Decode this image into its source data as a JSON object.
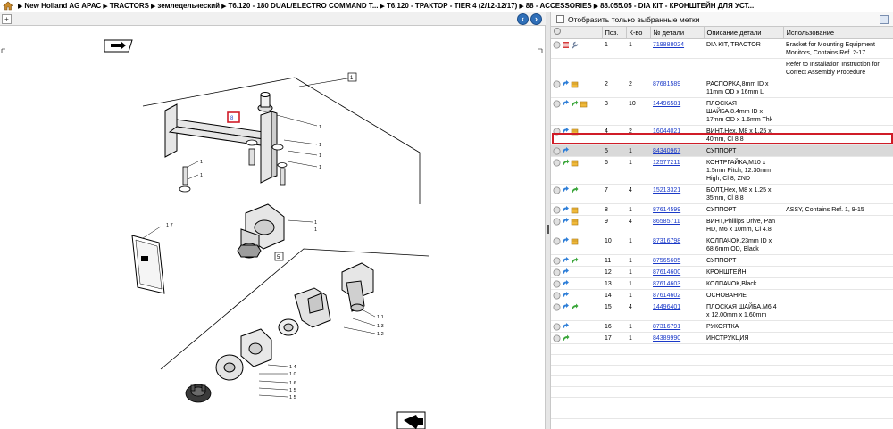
{
  "breadcrumb": {
    "items": [
      "New Holland AG APAC",
      "TRACTORS",
      "земледельческий",
      "T6.120 - 180 DUAL/ELECTRO COMMAND T...",
      "T6.120 - ТРАКТОР - TIER 4 (2/12-12/17)",
      "88 - ACCESSORIES",
      "88.055.05 - DIA КІТ - КРОНШТЕЙН ДЛЯ УСТ..."
    ]
  },
  "filter": {
    "label": "Отобразить только выбранные метки"
  },
  "table": {
    "headers": [
      "Поз.",
      "К-во",
      "№ детали",
      "Описание детали",
      "Использование"
    ],
    "rows": [
      {
        "pos": "1",
        "qty": "1",
        "part": "719888024",
        "desc": "DIA KIT, TRACTOR",
        "usage": "Bracket for Mounting Equipment Monitors, Contains Ref. 2-17"
      },
      {
        "pos": "",
        "qty": "",
        "part": "",
        "desc": "",
        "usage": "Refer to Installation Instruction for Correct Assembly Procedure"
      },
      {
        "pos": "2",
        "qty": "2",
        "part": "87681589",
        "desc": "РАСПОРКА,8mm ID x 11mm OD x 16mm L",
        "usage": ""
      },
      {
        "pos": "3",
        "qty": "10",
        "part": "14496581",
        "desc": "ПЛОСКАЯ ШАЙБА,8.4mm ID x 17mm OD x 1.6mm Thk",
        "usage": ""
      },
      {
        "pos": "4",
        "qty": "2",
        "part": "16044021",
        "desc": "ВИНТ,Hex, M8 x 1.25 x 40mm, Cl 8.8",
        "usage": ""
      },
      {
        "pos": "5",
        "qty": "1",
        "part": "84340967",
        "desc": "СУППОРТ",
        "usage": ""
      },
      {
        "pos": "6",
        "qty": "1",
        "part": "12577211",
        "desc": "КОНТРГАЙКА,M10 x 1.5mm Pitch, 12.30mm High, Cl 8, ZND",
        "usage": ""
      },
      {
        "pos": "7",
        "qty": "4",
        "part": "15213321",
        "desc": "БОЛТ,Hex, M8 x 1.25 x 35mm, Cl 8.8",
        "usage": ""
      },
      {
        "pos": "8",
        "qty": "1",
        "part": "87614599",
        "desc": "СУППОРТ",
        "usage": "ASSY, Contains Ref. 1, 9-15"
      },
      {
        "pos": "9",
        "qty": "4",
        "part": "86585711",
        "desc": "ВИНТ,Phillips Drive, Pan HD, M6 x 10mm, Cl 4.8",
        "usage": ""
      },
      {
        "pos": "10",
        "qty": "1",
        "part": "87316798",
        "desc": "КОЛПАЧОК,23mm ID x 68.6mm OD, Black",
        "usage": ""
      },
      {
        "pos": "11",
        "qty": "1",
        "part": "87565605",
        "desc": "СУППОРТ",
        "usage": ""
      },
      {
        "pos": "12",
        "qty": "1",
        "part": "87614600",
        "desc": "КРОНШТЕЙН",
        "usage": ""
      },
      {
        "pos": "13",
        "qty": "1",
        "part": "87614603",
        "desc": "КОЛПАЧОК,Black",
        "usage": ""
      },
      {
        "pos": "14",
        "qty": "1",
        "part": "87614602",
        "desc": "ОСНОВАНИЕ",
        "usage": ""
      },
      {
        "pos": "15",
        "qty": "4",
        "part": "14496401",
        "desc": "ПЛОСКАЯ ШАЙБА,M6.4 x 12.00mm x 1.60mm",
        "usage": ""
      },
      {
        "pos": "16",
        "qty": "1",
        "part": "87316791",
        "desc": "РУКОЯТКА",
        "usage": ""
      },
      {
        "pos": "17",
        "qty": "1",
        "part": "84389990",
        "desc": "ИНСТРУКЦИЯ",
        "usage": ""
      }
    ]
  },
  "diagram": {
    "callouts": [
      "1",
      "5",
      "8",
      "11",
      "15",
      "17"
    ]
  },
  "colors": {
    "selection": "#d01c28",
    "link": "#1a39c8",
    "nav": "#2f6fb8"
  }
}
